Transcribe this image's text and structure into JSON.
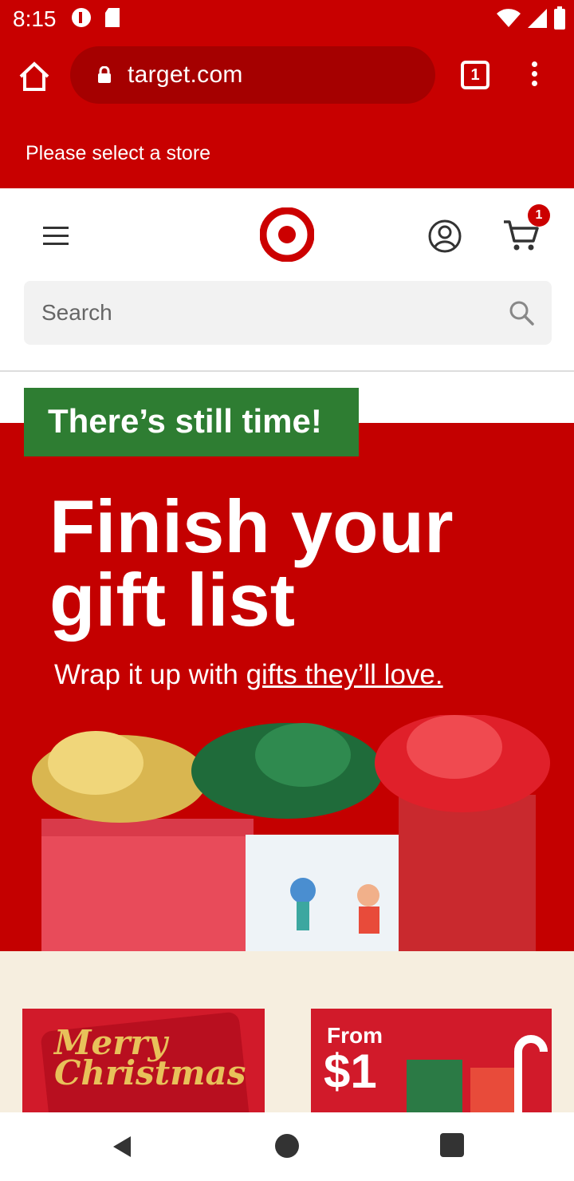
{
  "status_bar": {
    "time": "8:15"
  },
  "browser": {
    "url": "target.com",
    "tab_count": "1"
  },
  "store_bar": {
    "text": "Please select a store"
  },
  "header": {
    "cart_count": "1",
    "search_placeholder": "Search"
  },
  "hero": {
    "badge": "There’s still time!",
    "title_line1": "Finish your",
    "title_line2": "gift list",
    "subtitle_prefix": "Wrap it up with ",
    "subtitle_link": "gifts they’ll love."
  },
  "promos": {
    "christmas_text_line1": "Merry",
    "christmas_text_line2": "Christmas",
    "from_label": "From",
    "price": "$1"
  },
  "colors": {
    "brand_red": "#c80000",
    "badge_green": "#2e7d32"
  }
}
